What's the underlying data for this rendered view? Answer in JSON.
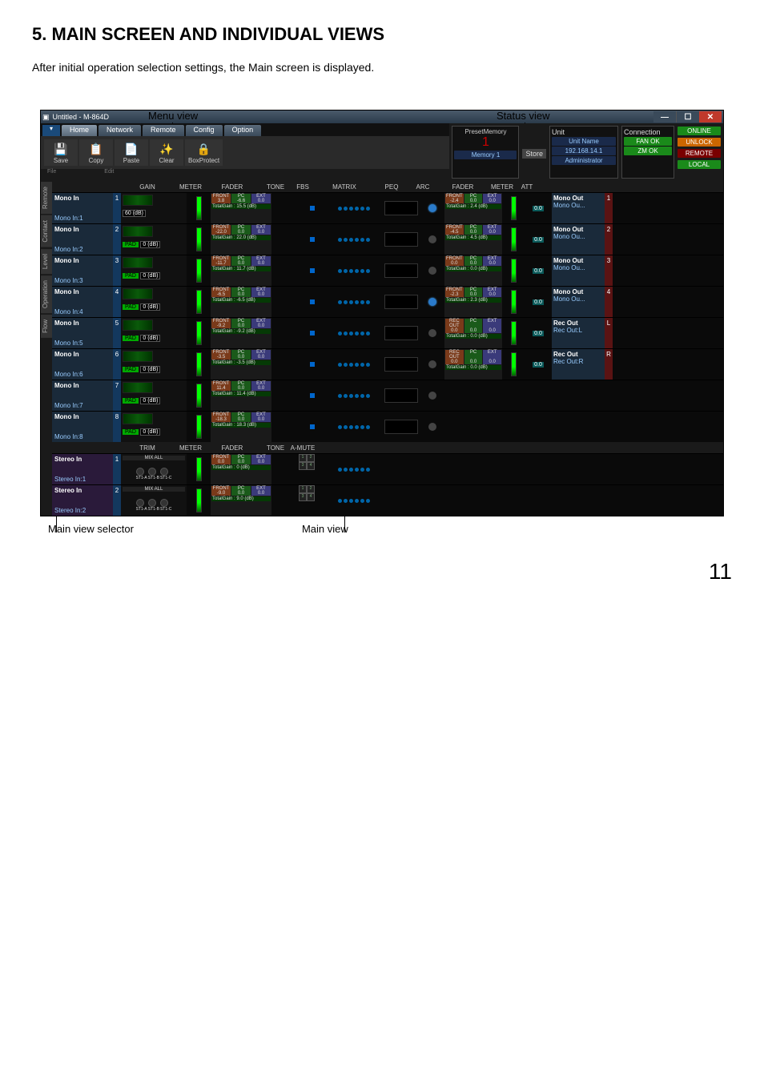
{
  "doc": {
    "heading": "5. MAIN SCREEN AND INDIVIDUAL VIEWS",
    "intro": "After initial operation selection settings, the Main screen is displayed.",
    "label_menu_view": "Menu view",
    "label_status_view": "Status view",
    "label_main_selector": "Main view selector",
    "label_main_view": "Main view",
    "page_number": "11"
  },
  "titlebar": {
    "title": "Untitled - M-864D"
  },
  "tabs": [
    "Home",
    "Network",
    "Remote",
    "Config",
    "Option"
  ],
  "toolbar": [
    {
      "icon": "💾",
      "label": "Save"
    },
    {
      "icon": "📋",
      "label": "Copy"
    },
    {
      "icon": "📄",
      "label": "Paste"
    },
    {
      "icon": "✨",
      "label": "Clear"
    },
    {
      "icon": "🔒",
      "label": "BoxProtect"
    }
  ],
  "groups": {
    "file": "File",
    "edit": "Edit"
  },
  "preset": {
    "header": "PresetMemory",
    "num": "1",
    "name": "Memory 1",
    "store": "Store"
  },
  "unit": {
    "header": "Unit",
    "name_lbl": "Unit Name",
    "ip": "192.168.14.1",
    "role": "Administrator"
  },
  "connection": {
    "header": "Connection",
    "fan": "FAN OK",
    "zm": "ZM OK"
  },
  "status_badges": {
    "online": "ONLINE",
    "unlock": "UNLOCK",
    "remote": "REMOTE",
    "local": "LOCAL"
  },
  "in_headers": [
    "GAIN",
    "METER",
    "FADER",
    "TONE",
    "FBS",
    "MATRIX",
    "PEQ",
    "ARC"
  ],
  "out_headers": [
    "FADER",
    "METER",
    "ATT"
  ],
  "stereo_headers": [
    "TRIM",
    "METER",
    "FADER",
    "TONE",
    "A-MUTE"
  ],
  "fader_seg": {
    "front": "FRONT",
    "pc": "PC",
    "ext": "EXT"
  },
  "selector": [
    "Remote",
    "Contact",
    "Level",
    "Operation",
    "Flow"
  ],
  "mono_in": [
    {
      "num": "1",
      "name": "Mono In",
      "sub": "Mono In:1",
      "pad": "",
      "gain": "60 (dB)",
      "fv": [
        "3.8",
        "-6.6",
        "0.0"
      ],
      "total": "TotalGain : 15.5 (dB)",
      "arc": true
    },
    {
      "num": "2",
      "name": "Mono In",
      "sub": "Mono In:2",
      "pad": "PAD",
      "gain": "0 (dB)",
      "fv": [
        "-22.0",
        "0.0",
        "0.0"
      ],
      "total": "TotalGain : 22.0 (dB)",
      "arc": false
    },
    {
      "num": "3",
      "name": "Mono In",
      "sub": "Mono In:3",
      "pad": "PAD",
      "gain": "0 (dB)",
      "fv": [
        "-11.7",
        "0.0",
        "0.0"
      ],
      "total": "TotalGain : 11.7 (dB)",
      "arc": false
    },
    {
      "num": "4",
      "name": "Mono In",
      "sub": "Mono In:4",
      "pad": "PAD",
      "gain": "0 (dB)",
      "fv": [
        "-6.5",
        "0.0",
        "0.0"
      ],
      "total": "TotalGain : -6.5 (dB)",
      "arc": true
    },
    {
      "num": "5",
      "name": "Mono In",
      "sub": "Mono In:5",
      "pad": "PAD",
      "gain": "0 (dB)",
      "fv": [
        "-9.2",
        "0.0",
        "0.0"
      ],
      "total": "TotalGain : -9.2 (dB)",
      "arc": false
    },
    {
      "num": "6",
      "name": "Mono In",
      "sub": "Mono In:6",
      "pad": "PAD",
      "gain": "0 (dB)",
      "fv": [
        "-3.5",
        "0.0",
        "0.0"
      ],
      "total": "TotalGain : -3.5 (dB)",
      "arc": false
    },
    {
      "num": "7",
      "name": "Mono In",
      "sub": "Mono In:7",
      "pad": "PAD",
      "gain": "0 (dB)",
      "fv": [
        "11.4",
        "0.0",
        "0.0"
      ],
      "total": "TotalGain : 11.4 (dB)",
      "arc": false
    },
    {
      "num": "8",
      "name": "Mono In",
      "sub": "Mono In:8",
      "pad": "PAD",
      "gain": "0 (dB)",
      "fv": [
        "-18.3",
        "0.0",
        "0.0"
      ],
      "total": "TotalGain : 18.3 (dB)",
      "arc": false
    }
  ],
  "stereo_in": [
    {
      "num": "1",
      "name": "Stereo In",
      "sub": "Stereo In:1",
      "mix": "MIX ALL",
      "fv": [
        "0.0",
        "0.0",
        "0.0"
      ],
      "total": "TotalGain : 0 (dB)"
    },
    {
      "num": "2",
      "name": "Stereo In",
      "sub": "Stereo In:2",
      "mix": "MIX ALL",
      "fv": [
        "-9.0",
        "0.0",
        "0.0"
      ],
      "total": "TotalGain : 9.0 (dB)"
    }
  ],
  "stereo_trim_labels": [
    "ST1-A",
    "ST1-B",
    "ST1-C"
  ],
  "mono_out": [
    {
      "num": "1",
      "name": "Mono Out",
      "sub": "Mono Ou...",
      "fv": [
        "-2.4",
        "0.0",
        "0.0"
      ],
      "total": "TotalGain : 2.4 (dB)",
      "att": "0.0"
    },
    {
      "num": "2",
      "name": "Mono Out",
      "sub": "Mono Ou...",
      "fv": [
        "-4.5",
        "0.0",
        "0.0"
      ],
      "total": "TotalGain : 4.5 (dB)",
      "att": "0.0"
    },
    {
      "num": "3",
      "name": "Mono Out",
      "sub": "Mono Ou...",
      "fv": [
        "0.0",
        "0.0",
        "0.0"
      ],
      "total": "TotalGain : 0.0 (dB)",
      "att": "0.0"
    },
    {
      "num": "4",
      "name": "Mono Out",
      "sub": "Mono Ou...",
      "fv": [
        "-2.3",
        "0.0",
        "0.0"
      ],
      "total": "TotalGain : 2.3 (dB)",
      "att": "0.0"
    }
  ],
  "rec_out": [
    {
      "num": "L",
      "name": "Rec Out",
      "sub": "Rec Out:L",
      "seg": "REC OUT",
      "fv": [
        "0.0",
        "0.0",
        "0.0"
      ],
      "total": "TotalGain : 0.0 (dB)",
      "att": "0.0"
    },
    {
      "num": "R",
      "name": "Rec Out",
      "sub": "Rec Out:R",
      "seg": "REC OUT",
      "fv": [
        "0.0",
        "0.0",
        "0.0"
      ],
      "total": "TotalGain : 0.0 (dB)",
      "att": "0.0"
    }
  ]
}
